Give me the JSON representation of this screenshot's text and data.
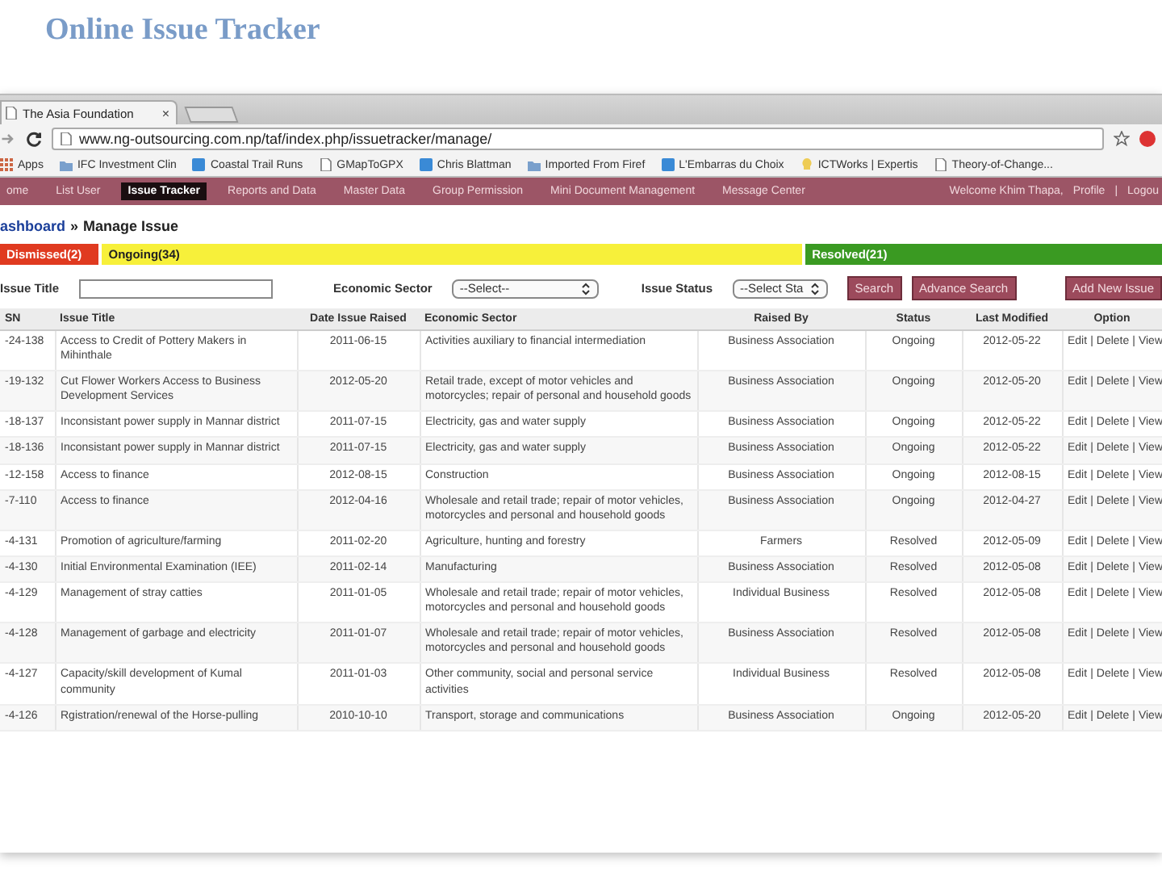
{
  "slide_title": "Online Issue Tracker",
  "browser": {
    "tab_title": "The Asia Foundation",
    "tab_close": "×",
    "url": "www.ng-outsourcing.com.np/taf/index.php/issuetracker/manage/",
    "bookmarks": [
      {
        "label": "Apps",
        "kind": "apps"
      },
      {
        "label": "IFC Investment Clin",
        "kind": "folder"
      },
      {
        "label": "Coastal Trail Runs",
        "kind": "site"
      },
      {
        "label": "GMapToGPX",
        "kind": "page"
      },
      {
        "label": "Chris Blattman",
        "kind": "site"
      },
      {
        "label": "Imported From Firef",
        "kind": "folder"
      },
      {
        "label": "L'Embarras du Choix",
        "kind": "site"
      },
      {
        "label": "ICTWorks | Expertis",
        "kind": "bulb"
      },
      {
        "label": "Theory-of-Change...",
        "kind": "page"
      }
    ]
  },
  "nav": {
    "items": [
      {
        "label": "ome",
        "selected": false
      },
      {
        "label": "List User",
        "selected": false
      },
      {
        "label": "Issue Tracker",
        "selected": true
      },
      {
        "label": "Reports and Data",
        "selected": false
      },
      {
        "label": "Master Data",
        "selected": false
      },
      {
        "label": "Group Permission",
        "selected": false
      },
      {
        "label": "Mini Document Management",
        "selected": false
      },
      {
        "label": "Message Center",
        "selected": false
      }
    ],
    "welcome": "Welcome Khim Thapa,",
    "profile": "Profile",
    "separator": "|",
    "logout": "Logou"
  },
  "breadcrumb": {
    "link": "ashboard",
    "separator": "»",
    "current": "Manage Issue"
  },
  "status_tabs": [
    {
      "label": "Dismissed(2)",
      "color": "#e03a20"
    },
    {
      "label": "Ongoing(34)",
      "color": "#f7f03a"
    },
    {
      "label": "Resolved(21)",
      "color": "#3a9a22"
    }
  ],
  "filters": {
    "issue_title_label": "Issue Title",
    "sector_label": "Economic Sector",
    "sector_value": "--Select--",
    "status_label": "Issue Status",
    "status_value": "--Select Sta",
    "search": "Search",
    "advance_search": "Advance Search",
    "add_new": "Add New Issue"
  },
  "table": {
    "columns": [
      "SN",
      "Issue Title",
      "Date Issue Raised",
      "Economic Sector",
      "Raised By",
      "Status",
      "Last Modified",
      "Option"
    ],
    "rows": [
      {
        "cells": [
          "-24-138",
          "Access to Credit of Pottery Makers in Mihinthale",
          "2011-06-15",
          "Activities auxiliary to financial intermediation",
          "Business Association",
          "Ongoing",
          "2012-05-22"
        ],
        "options": [
          "Edit",
          "Delete",
          "View"
        ],
        "separators": [
          "|",
          "|"
        ]
      },
      {
        "cells": [
          "-19-132",
          "Cut Flower Workers Access to Business Development Services",
          "2012-05-20",
          "Retail trade, except of motor vehicles and motorcycles; repair of personal and household goods",
          "Business Association",
          "Ongoing",
          "2012-05-20"
        ],
        "options": [
          "Edit",
          "Delete",
          "View"
        ],
        "separators": [
          "|",
          "|"
        ]
      },
      {
        "cells": [
          "-18-137",
          "Inconsistant power supply in Mannar district",
          "2011-07-15",
          "Electricity, gas and water supply",
          "Business Association",
          "Ongoing",
          "2012-05-22"
        ],
        "options": [
          "Edit",
          "Delete",
          "View"
        ],
        "separators": [
          "|",
          "|"
        ]
      },
      {
        "cells": [
          "-18-136",
          "Inconsistant power supply in Mannar district",
          "2011-07-15",
          "Electricity, gas and water supply",
          "Business Association",
          "Ongoing",
          "2012-05-22"
        ],
        "options": [
          "Edit",
          "Delete",
          "View"
        ],
        "separators": [
          "|",
          "|"
        ]
      },
      {
        "cells": [
          "-12-158",
          "Access to finance",
          "2012-08-15",
          "Construction",
          "Business Association",
          "Ongoing",
          "2012-08-15"
        ],
        "options": [
          "Edit",
          "Delete",
          "View"
        ],
        "separators": [
          "|",
          "|"
        ]
      },
      {
        "cells": [
          "-7-110",
          "Access to finance",
          "2012-04-16",
          "Wholesale and retail trade; repair of motor vehicles, motorcycles and personal and household goods",
          "Business Association",
          "Ongoing",
          "2012-04-27"
        ],
        "options": [
          "Edit",
          "Delete",
          "View"
        ],
        "separators": [
          "|",
          "|"
        ]
      },
      {
        "cells": [
          "-4-131",
          "Promotion of agriculture/farming",
          "2011-02-20",
          "Agriculture, hunting and forestry",
          "Farmers",
          "Resolved",
          "2012-05-09"
        ],
        "options": [
          "Edit",
          "Delete",
          "View"
        ],
        "separators": [
          "|",
          "|"
        ]
      },
      {
        "cells": [
          "-4-130",
          "Initial Environmental Examination (IEE)",
          "2011-02-14",
          "Manufacturing",
          "Business Association",
          "Resolved",
          "2012-05-08"
        ],
        "options": [
          "Edit",
          "Delete",
          "View"
        ],
        "separators": [
          "|",
          "|"
        ]
      },
      {
        "cells": [
          "-4-129",
          "Management of stray catties",
          "2011-01-05",
          "Wholesale and retail trade; repair of motor vehicles, motorcycles and personal and household goods",
          "Individual Business",
          "Resolved",
          "2012-05-08"
        ],
        "options": [
          "Edit",
          "Delete",
          "View"
        ],
        "separators": [
          "|",
          "|"
        ]
      },
      {
        "cells": [
          "-4-128",
          "Management of garbage and electricity",
          "2011-01-07",
          "Wholesale and retail trade; repair of motor vehicles, motorcycles and personal and household goods",
          "Business Association",
          "Resolved",
          "2012-05-08"
        ],
        "options": [
          "Edit",
          "Delete",
          "View"
        ],
        "separators": [
          "|",
          "|"
        ]
      },
      {
        "cells": [
          "-4-127",
          "Capacity/skill development of Kumal community",
          "2011-01-03",
          "Other community, social and personal service activities",
          "Individual Business",
          "Resolved",
          "2012-05-08"
        ],
        "options": [
          "Edit",
          "Delete",
          "View"
        ],
        "separators": [
          "|",
          "|"
        ]
      },
      {
        "cells": [
          "-4-126",
          "Rgistration/renewal of the Horse-pulling",
          "2010-10-10",
          "Transport, storage and communications",
          "Business Association",
          "Ongoing",
          "2012-05-20"
        ],
        "options": [
          "Edit",
          "Delete",
          "View"
        ],
        "separators": [
          "|",
          "|"
        ]
      }
    ]
  }
}
